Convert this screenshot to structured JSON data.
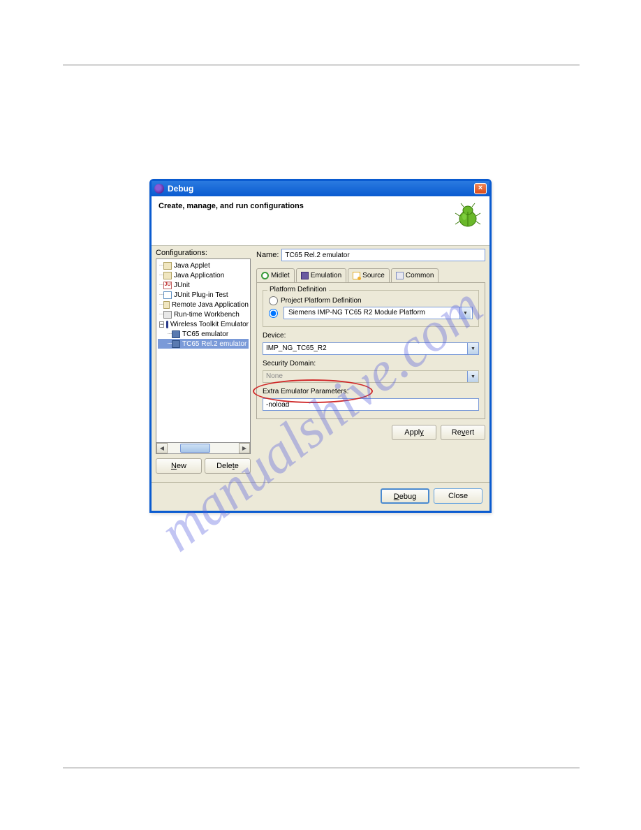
{
  "dialog": {
    "title": "Debug",
    "subtitle": "Create, manage, and run configurations"
  },
  "watermark": "manualshive.com",
  "left": {
    "configurations_label": "Configurations:",
    "tree": {
      "java_applet": "Java Applet",
      "java_application": "Java Application",
      "junit": "JUnit",
      "junit_plugin": "JUnit Plug-in Test",
      "remote_java": "Remote Java Application",
      "runtime_wb": "Run-time Workbench",
      "wireless_toolkit": "Wireless Toolkit Emulator",
      "tc65_emulator": "TC65 emulator",
      "tc65_rel2_emulator": "TC65 Rel.2 emulator"
    },
    "new_btn": "New",
    "delete_btn": "Delete"
  },
  "right": {
    "name_label": "Name:",
    "name_value": "TC65 Rel.2 emulator",
    "tabs": {
      "midlet": "Midlet",
      "emulation": "Emulation",
      "source": "Source",
      "common": "Common"
    },
    "platform_def_legend": "Platform Definition",
    "radio_project": "Project Platform Definition",
    "platform_value": "Siemens IMP-NG TC65 R2 Module Platform",
    "device_label": "Device:",
    "device_value": "IMP_NG_TC65_R2",
    "security_label": "Security Domain:",
    "security_value": "None",
    "extra_label": "Extra Emulator Parameters:",
    "extra_value": "-noload",
    "apply_btn": "Apply",
    "revert_btn": "Revert"
  },
  "footer": {
    "debug_btn": "Debug",
    "close_btn": "Close"
  }
}
